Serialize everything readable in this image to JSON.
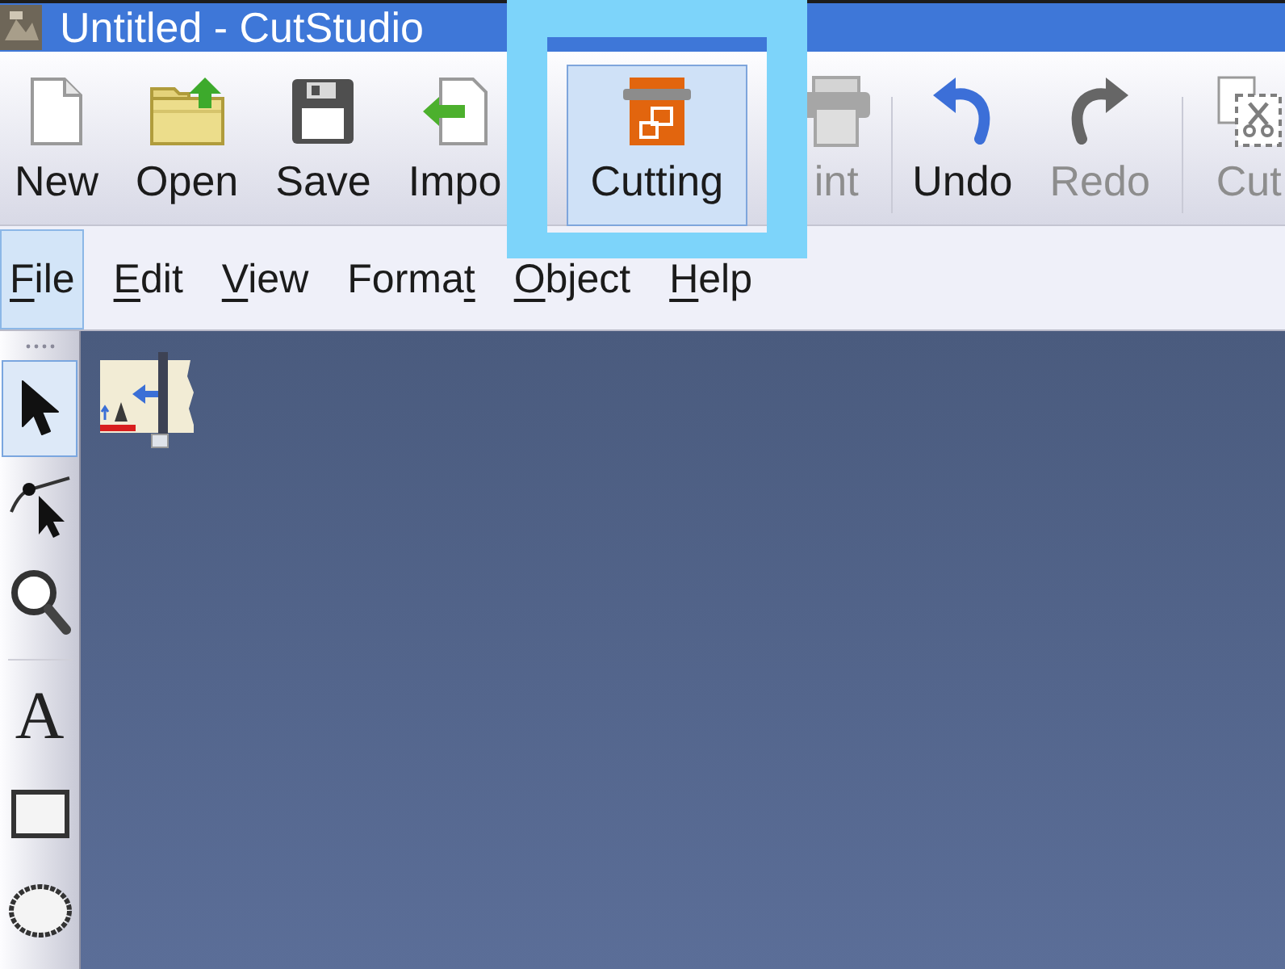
{
  "window": {
    "title": "Untitled - CutStudio"
  },
  "toolbar": {
    "groups": [
      {
        "items": [
          {
            "kind": "new",
            "label": "New",
            "selected": false,
            "disabled": false,
            "highlighted": false
          },
          {
            "kind": "open",
            "label": "Open",
            "selected": false,
            "disabled": false,
            "highlighted": false
          },
          {
            "kind": "save",
            "label": "Save",
            "selected": false,
            "disabled": false,
            "highlighted": false
          },
          {
            "kind": "import",
            "label": "Impo",
            "selected": false,
            "disabled": false,
            "highlighted": false
          }
        ]
      },
      {
        "items": [
          {
            "kind": "cutting",
            "label": "Cutting",
            "selected": true,
            "disabled": false,
            "highlighted": true
          },
          {
            "kind": "print",
            "label": "int",
            "selected": false,
            "disabled": true,
            "highlighted": false
          }
        ]
      },
      {
        "items": [
          {
            "kind": "undo",
            "label": "Undo",
            "selected": false,
            "disabled": false,
            "highlighted": false
          },
          {
            "kind": "redo",
            "label": "Redo",
            "selected": false,
            "disabled": true,
            "highlighted": false
          }
        ]
      },
      {
        "items": [
          {
            "kind": "cut",
            "label": "Cut",
            "selected": false,
            "disabled": true,
            "highlighted": false
          }
        ]
      }
    ]
  },
  "menu": [
    {
      "access_key": "F",
      "after": "ile",
      "selected": true
    },
    {
      "access_key": "E",
      "after": "dit",
      "selected": false
    },
    {
      "access_key": "V",
      "after": "iew",
      "selected": false
    },
    {
      "before": "Forma",
      "access_key": "t",
      "selected": false
    },
    {
      "access_key": "O",
      "after": "bject",
      "selected": false
    },
    {
      "access_key": "H",
      "after": "elp",
      "selected": false
    }
  ],
  "tools": {
    "groups": [
      {
        "items": [
          {
            "kind": "pointer",
            "selected": true
          },
          {
            "kind": "node_edit",
            "selected": false
          },
          {
            "kind": "zoom",
            "selected": false
          }
        ]
      },
      {
        "items": [
          {
            "kind": "text",
            "label": "A",
            "selected": false
          },
          {
            "kind": "rectangle",
            "selected": false
          },
          {
            "kind": "ellipse",
            "selected": false
          }
        ]
      }
    ]
  }
}
